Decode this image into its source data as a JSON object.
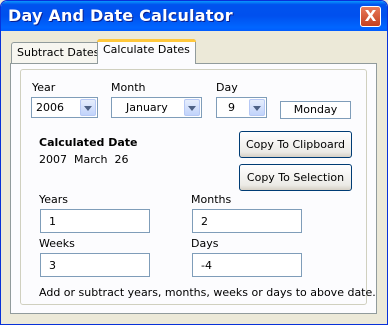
{
  "window": {
    "title": "Day And Date Calculator",
    "close_label": "X"
  },
  "tabs": [
    {
      "label": "Subtract Dates"
    },
    {
      "label": "Calculate Dates"
    }
  ],
  "date": {
    "year_label": "Year",
    "year_value": "2006",
    "month_label": "Month",
    "month_value": "January",
    "day_label": "Day",
    "day_value": "9",
    "weekday_value": "Monday"
  },
  "calculated": {
    "label": "Calculated Date",
    "value": "2007  March  26"
  },
  "buttons": {
    "copy_clipboard": "Copy To Clipboard",
    "copy_selection": "Copy To Selection"
  },
  "offsets": {
    "years_label": "Years",
    "years_value": "1",
    "months_label": "Months",
    "months_value": "2",
    "weeks_label": "Weeks",
    "weeks_value": "3",
    "days_label": "Days",
    "days_value": "-4"
  },
  "hint": "Add or subtract years, months, weeks or days to above date."
}
